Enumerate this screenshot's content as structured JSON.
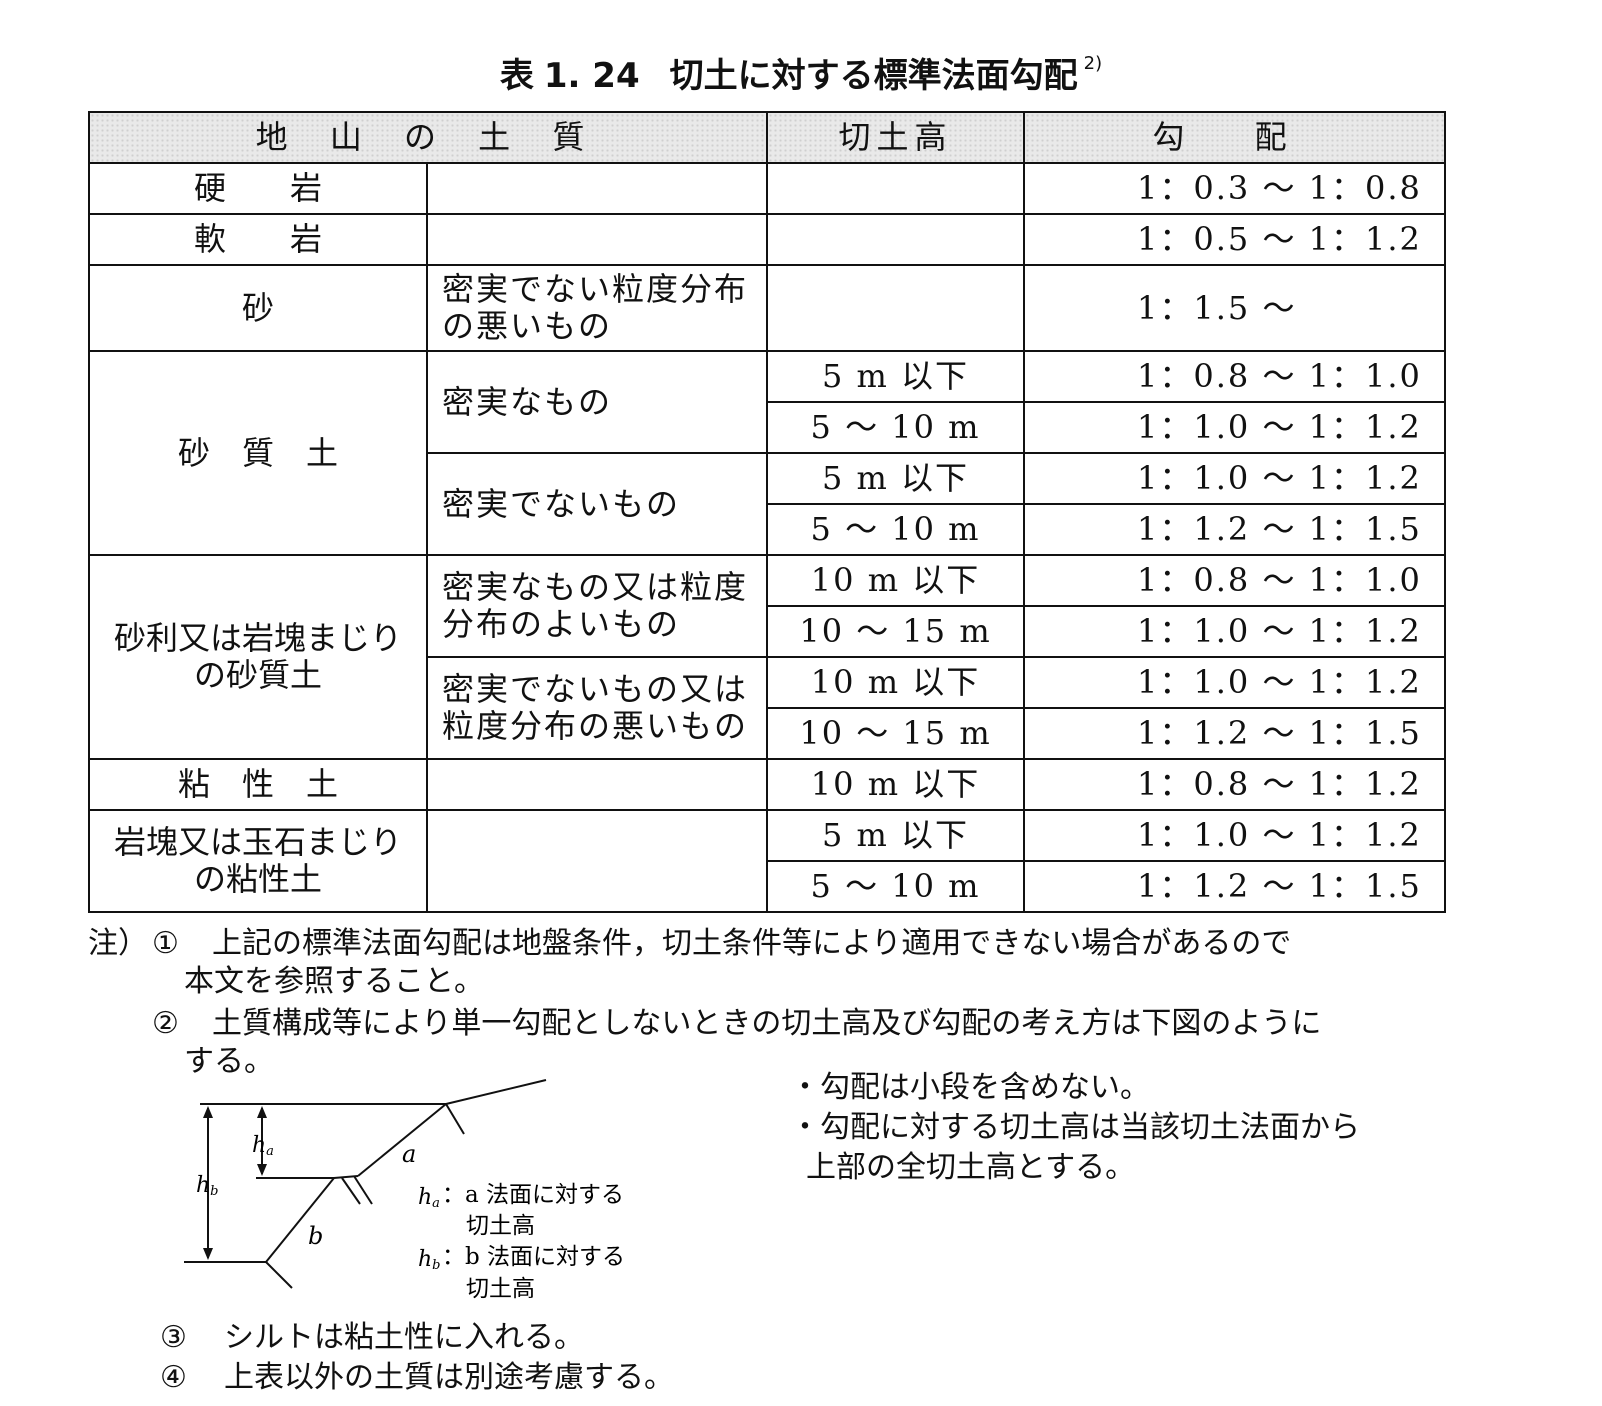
{
  "title": {
    "label": "表",
    "number": "1. 24",
    "text": "切土に対する標準法面勾配",
    "ref": "2)"
  },
  "table": {
    "headers": {
      "soil": "地 山 の 土 質",
      "height": "切土高",
      "slope": "勾 配"
    },
    "rows": [
      {
        "soil": "硬　　岩",
        "cond": "",
        "height": "",
        "slope": "1：0.3 ～ 1：0.8"
      },
      {
        "soil": "軟　　岩",
        "cond": "",
        "height": "",
        "slope": "1：0.5 ～ 1：1.2"
      },
      {
        "soil": "砂",
        "cond": "密実でない粒度分布の悪いもの",
        "height": "",
        "slope": "1：1.5 ～"
      },
      {
        "soil": "砂　質　土",
        "cond": "密実なもの",
        "height": "5 m 以下",
        "slope": "1：0.8 ～ 1：1.0"
      },
      {
        "height": "5 ～ 10 m",
        "slope": "1：1.0 ～ 1：1.2"
      },
      {
        "cond": "密実でないもの",
        "height": "5 m 以下",
        "slope": "1：1.0 ～ 1：1.2"
      },
      {
        "height": "5 ～ 10 m",
        "slope": "1：1.2 ～ 1：1.5"
      },
      {
        "soil": "砂利又は岩塊まじりの砂質土",
        "cond": "密実なもの又は粒度分布のよいもの",
        "height": "10 m 以下",
        "slope": "1：0.8 ～ 1：1.0"
      },
      {
        "height": "10 ～ 15 m",
        "slope": "1：1.0 ～ 1：1.2"
      },
      {
        "cond": "密実でないもの又は粒度分布の悪いもの",
        "height": "10 m 以下",
        "slope": "1：1.0 ～ 1：1.2"
      },
      {
        "height": "10 ～ 15 m",
        "slope": "1：1.2 ～ 1：1.5"
      },
      {
        "soil": "粘　性　土",
        "cond": "",
        "height": "10 m 以下",
        "slope": "1：0.8 ～ 1：1.2"
      },
      {
        "soil": "岩塊又は玉石まじりの粘性土",
        "cond": "",
        "height": "5 m 以下",
        "slope": "1：1.0 ～ 1：1.2"
      },
      {
        "height": "5 ～ 10 m",
        "slope": "1：1.2 ～ 1：1.5"
      }
    ]
  },
  "notes": {
    "prefix": "注）",
    "n1_mark": "①",
    "n1_line1": "上記の標準法面勾配は地盤条件，切土条件等により適用できない場合があるので",
    "n1_line2": "本文を参照すること。",
    "n2_mark": "②",
    "n2_line1": "土質構成等により単一勾配としないときの切土高及び勾配の考え方は下図のように",
    "n2_line2": "する。",
    "n3_mark": "③",
    "n3": "シルトは粘土性に入れる。",
    "n4_mark": "④",
    "n4": "上表以外の土質は別途考慮する。"
  },
  "diagram": {
    "ha": "h",
    "ha_sub": "a",
    "hb": "h",
    "hb_sub": "b",
    "a": "a",
    "b": "b",
    "legend_a_line1": "：a 法面に対する",
    "legend_a_line2": "切土高",
    "legend_b_line1": "：b 法面に対する",
    "legend_b_line2": "切土高"
  },
  "bullets": {
    "b1": "・勾配は小段を含めない。",
    "b2_line1": "・勾配に対する切土高は当該切土法面から",
    "b2_line2": "上部の全切土高とする。"
  }
}
